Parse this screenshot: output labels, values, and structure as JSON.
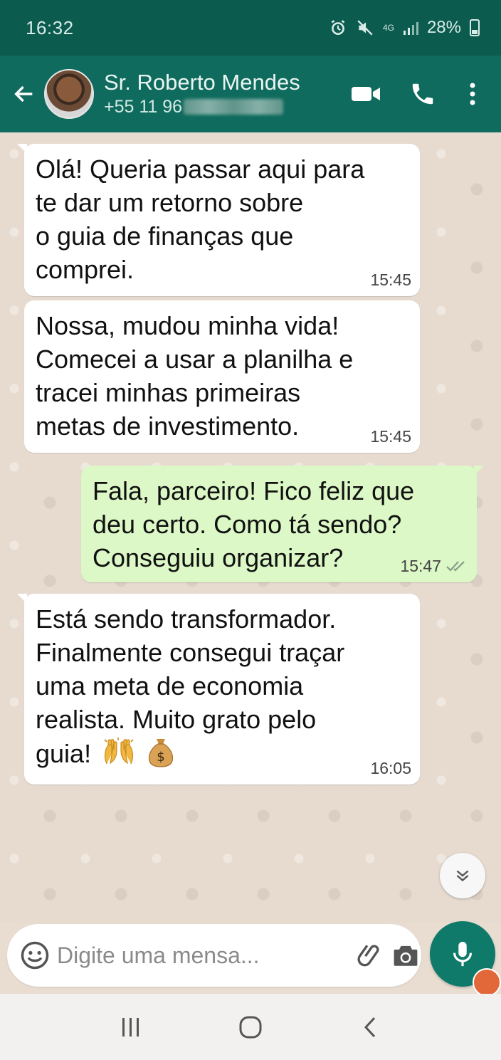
{
  "status_bar": {
    "time": "16:32",
    "network": "4G",
    "battery": "28%"
  },
  "header": {
    "contact_name": "Sr. Roberto Mendes",
    "contact_phone_visible": "+55 11 96"
  },
  "messages": [
    {
      "direction": "in",
      "text": "Olá! Queria passar aqui para\nte dar um retorno sobre\no guia de finanças que\ncomprei.",
      "time": "15:45"
    },
    {
      "direction": "in",
      "text": "Nossa, mudou minha vida!\nComecei a usar a planilha e\ntracei minhas primeiras\nmetas de investimento.",
      "time": "15:45"
    },
    {
      "direction": "out",
      "text": "Fala, parceiro! Fico feliz que\ndeu certo. Como tá sendo?\nConseguiu organizar?",
      "time": "15:47",
      "status": "read"
    },
    {
      "direction": "in",
      "text": "Está sendo transformador.\nFinalmente consegui traçar\numa meta de economia\nrealista. Muito grato pelo\nguia!",
      "time": "16:05",
      "emojis": [
        "raising-hands-icon",
        "money-bag-icon"
      ]
    }
  ],
  "input": {
    "placeholder": "Digite uma mensa..."
  },
  "colors": {
    "header": "#0f6b5d",
    "status_bar": "#0b5b4f",
    "outgoing_bubble": "#dcf8c6",
    "incoming_bubble": "#ffffff",
    "mic_button": "#0f7a69"
  }
}
